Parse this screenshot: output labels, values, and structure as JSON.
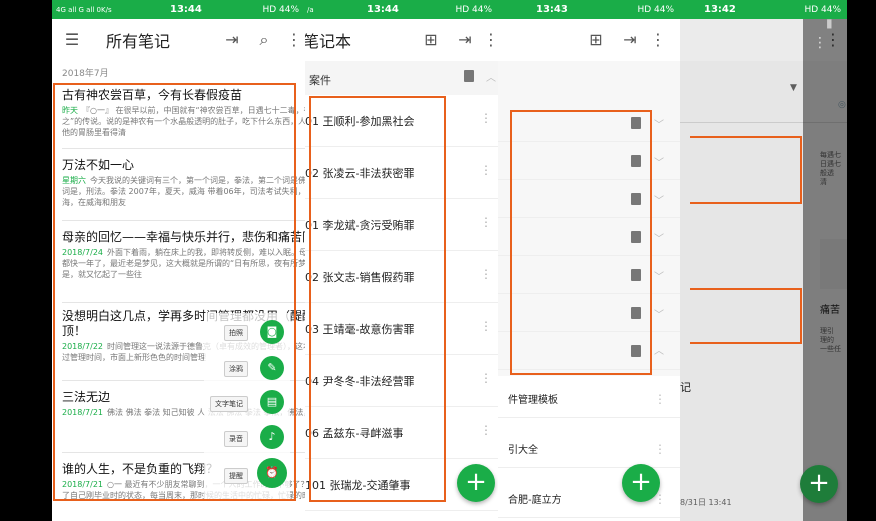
{
  "colors": {
    "accent": "#1aad48",
    "highlight": "#e8601c"
  },
  "status": {
    "signal": "4G all G all 0K/s",
    "battery": "HD 44%"
  },
  "panel1": {
    "time": "13:44",
    "title": "所有笔记",
    "section_date": "2018年7月",
    "notes": [
      {
        "title": "古有神农尝百草，今有长春假疫苗",
        "date": "昨天",
        "body": "『○一』 在很早以前，中国就有“神农尝百草，日遇七十二毒，得荼解之”的传说。说的是神农有一个水晶般透明的肚子，吃下什么东西，人们都可以从他的胃肠里看得清"
      },
      {
        "title": "万法不如一心",
        "date": "星期六",
        "body": "今天我说的关键词有三个，第一个词是，拳法，第二个词是佛法，第三个词是，刑法。拳法 2007年，夏天，威海 带着06年，司法考试失利，独去了威海，在威海和朋友"
      },
      {
        "title": "母亲的回忆——幸福与快乐并行，悲伤和痛苦同在！",
        "date": "2018/7/24",
        "body": "外面下着雨，躺在床上的我，即将转反侧，难以入眠。母亲，走了都快一年了，最近老是梦见，这大概就是所谓的“日有所思，夜有所梦”吧？于是，就又忆起了一些往"
      },
      {
        "title": "没想明白这几点，学再多时间管理都没用（醍醐灌顶！",
        "date": "2018/7/22",
        "body": "时间管理这一说法源于德鲁克（卓有成效的管理者），这本书中提到过管理时间，市面上新形色色的时间管理"
      },
      {
        "title": "三法无边",
        "date": "2018/7/21",
        "body": "佛法 佛法 拳法 知己知彼 人 法法 佛法 拳法 拳法，佛法，刑法"
      },
      {
        "title": "谁的人生，不是负重的飞翔？",
        "date": "2018/7/21",
        "body": "○一 最近有不少朋友常聊到，一个人的工作时间不够了？是就想起了自己刚毕业时的状态，每当周末，那时候的生活中的忙碌，忙碌的时候"
      }
    ],
    "fab_menu": [
      "拍照",
      "涂鸦",
      "文字笔记",
      "录音",
      "提醒"
    ]
  },
  "panel2": {
    "time": "13:44",
    "title": "笔记本",
    "group": "案件",
    "cases": [
      "01 王顺利-参加黑社会",
      "02 张凌云-非法获密罪",
      "01 李龙斌-贪污受贿罪",
      "02 张文志-销售假药罪",
      "03 王靖毫-故意伤害罪",
      "04 尹冬冬-非法经营罪",
      "06 孟兹东-寻衅滋事",
      "101 张瑞龙-交通肇事"
    ]
  },
  "panel3": {
    "time": "13:43",
    "items": [
      "件管理模板",
      "引大全",
      "合肥-庭立方"
    ]
  },
  "panel4": {
    "time": "13:42",
    "snips": [
      "每遇七\n日遇七\n般透\n清",
      "痛苦",
      "理引\n理的\n一些任"
    ],
    "label": "记",
    "timestamp": "8/31日 13:41"
  }
}
